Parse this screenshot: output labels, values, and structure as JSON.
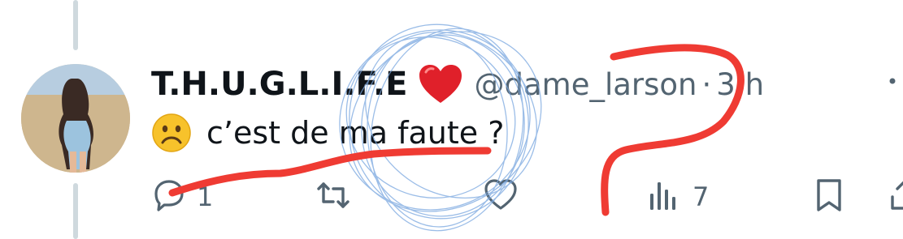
{
  "tweet": {
    "display_name": "T.H.U.G.L.I.F.E",
    "name_emoji": "red-heart",
    "handle": "@dame_larson",
    "separator": "·",
    "time": "3 h",
    "text": "c’est de ma faute ?",
    "text_emoji": "frowning-face"
  },
  "actions": {
    "reply_count": "1",
    "retweet_count": "",
    "like_count": "",
    "views_count": "7"
  },
  "colors": {
    "text_primary": "#0f1419",
    "text_secondary": "#536471",
    "annotation_red": "#ef3b33",
    "annotation_blue": "#7aa7e0"
  }
}
